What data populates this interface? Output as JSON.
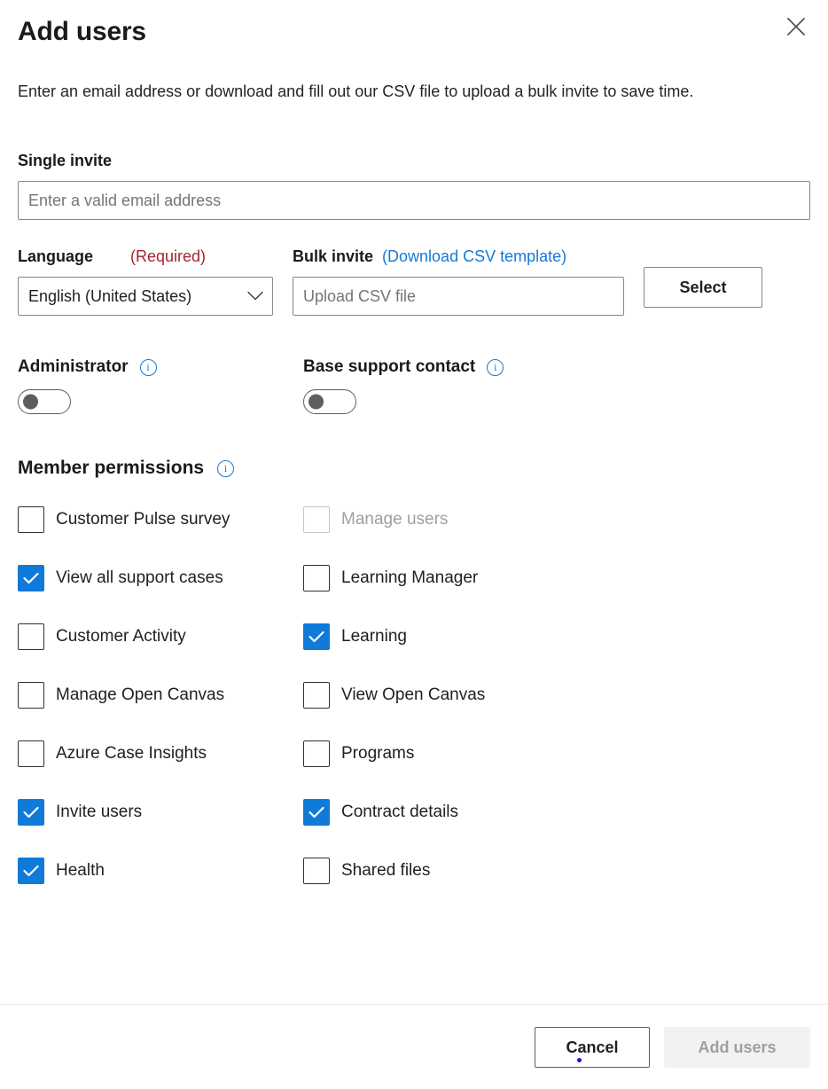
{
  "dialog": {
    "title": "Add users",
    "close_icon": "close-icon",
    "intro": "Enter an email address or download and fill out our CSV file to upload a bulk invite to save time."
  },
  "single_invite": {
    "label": "Single invite",
    "placeholder": "Enter a valid email address",
    "value": ""
  },
  "language": {
    "label": "Language",
    "required_text": "(Required)",
    "selected": "English (United States)",
    "chevron_icon": "chevron-down-icon"
  },
  "bulk_invite": {
    "label": "Bulk invite",
    "download_link": "(Download CSV template)",
    "placeholder": "Upload CSV file",
    "value": "",
    "select_button": "Select"
  },
  "toggles": [
    {
      "label": "Administrator",
      "on": false,
      "info_icon": "info-icon"
    },
    {
      "label": "Base support contact",
      "on": false,
      "info_icon": "info-icon"
    }
  ],
  "member_permissions": {
    "title": "Member permissions",
    "info_icon": "info-icon",
    "left_column": [
      {
        "label": "Customer Pulse survey",
        "checked": false,
        "disabled": false
      },
      {
        "label": "View all support cases",
        "checked": true,
        "disabled": false
      },
      {
        "label": "Customer Activity",
        "checked": false,
        "disabled": false
      },
      {
        "label": "Manage Open Canvas",
        "checked": false,
        "disabled": false
      },
      {
        "label": "Azure Case Insights",
        "checked": false,
        "disabled": false
      },
      {
        "label": "Invite users",
        "checked": true,
        "disabled": false
      },
      {
        "label": "Health",
        "checked": true,
        "disabled": false
      }
    ],
    "right_column": [
      {
        "label": "Manage users",
        "checked": false,
        "disabled": true
      },
      {
        "label": "Learning Manager",
        "checked": false,
        "disabled": false
      },
      {
        "label": "Learning",
        "checked": true,
        "disabled": false
      },
      {
        "label": "View Open Canvas",
        "checked": false,
        "disabled": false
      },
      {
        "label": "Programs",
        "checked": false,
        "disabled": false
      },
      {
        "label": "Contract details",
        "checked": true,
        "disabled": false
      },
      {
        "label": "Shared files",
        "checked": false,
        "disabled": false
      }
    ]
  },
  "footer": {
    "cancel_label": "Cancel",
    "submit_label": "Add users",
    "submit_disabled": true
  },
  "colors": {
    "accent_blue": "#0f7ad8",
    "link_blue": "#1579d6",
    "required_red": "#a4262c",
    "disabled_text": "#a19f9d",
    "disabled_bg": "#f3f2f1",
    "border_gray": "#8a8886",
    "text": "#201f1e"
  }
}
